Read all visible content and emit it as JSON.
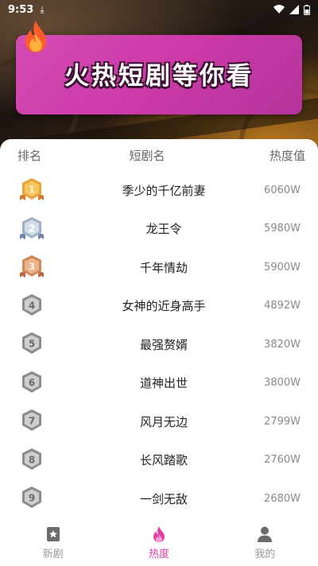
{
  "status": {
    "time": "9:53"
  },
  "banner": {
    "title": "火热短剧等你看"
  },
  "table": {
    "headers": {
      "rank": "排名",
      "name": "短剧名",
      "heat": "热度值"
    },
    "rows": [
      {
        "rank": "1",
        "name": "季少的千亿前妻",
        "heat": "6060W",
        "medal": "gold"
      },
      {
        "rank": "2",
        "name": "龙王令",
        "heat": "5980W",
        "medal": "silver"
      },
      {
        "rank": "3",
        "name": "千年情劫",
        "heat": "5900W",
        "medal": "bronze"
      },
      {
        "rank": "4",
        "name": "女神的近身高手",
        "heat": "4892W",
        "medal": "gray"
      },
      {
        "rank": "5",
        "name": "最强赘婿",
        "heat": "3820W",
        "medal": "gray"
      },
      {
        "rank": "6",
        "name": "道神出世",
        "heat": "3800W",
        "medal": "gray"
      },
      {
        "rank": "7",
        "name": "风月无边",
        "heat": "2799W",
        "medal": "gray"
      },
      {
        "rank": "8",
        "name": "长风踏歌",
        "heat": "2760W",
        "medal": "gray"
      },
      {
        "rank": "9",
        "name": "一剑无敌",
        "heat": "2680W",
        "medal": "gray"
      }
    ]
  },
  "tabs": [
    {
      "label": "新剧",
      "icon": "star-bookmark-icon",
      "active": false
    },
    {
      "label": "热度",
      "icon": "flame-icon",
      "active": true
    },
    {
      "label": "我的",
      "icon": "user-icon",
      "active": false
    }
  ],
  "colors": {
    "accent": "#e040a6",
    "banner": "#cc3aa8",
    "gold": "#e9a23b",
    "silver": "#9fb1c7",
    "bronze": "#d08a5a",
    "gray": "#8c8c8c"
  }
}
